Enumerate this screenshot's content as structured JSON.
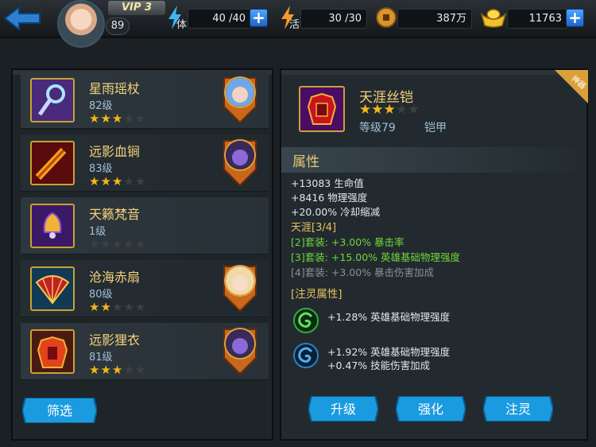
{
  "header": {
    "vip": "VIP 3",
    "player_level": "89",
    "stamina_label": "体",
    "stamina": "40 /40",
    "energy_label": "活",
    "energy": "30 /30",
    "coins": "387万",
    "gold": "11763"
  },
  "items": [
    {
      "name": "星雨瑶杖",
      "level": "82级",
      "stars": 3,
      "icon": "staff-icon",
      "hero": "hero-blue-hair-icon"
    },
    {
      "name": "远影血锏",
      "level": "83级",
      "stars": 3,
      "icon": "mace-icon",
      "hero": "hero-purple-elf-icon"
    },
    {
      "name": "天籁梵音",
      "level": "1级",
      "stars": 0,
      "icon": "bell-icon",
      "hero": ""
    },
    {
      "name": "沧海赤扇",
      "level": "80级",
      "stars": 2,
      "icon": "fan-icon",
      "hero": "hero-blonde-icon"
    },
    {
      "name": "远影狸衣",
      "level": "81级",
      "stars": 3,
      "icon": "armor-icon",
      "hero": "hero-purple-elf-icon"
    }
  ],
  "filter_label": "筛选",
  "detail": {
    "name": "天涯丝铠",
    "stars": 3,
    "level": "等级79",
    "type": "铠甲",
    "tag": "神器",
    "attr_title": "属性",
    "stats": [
      "+13083 生命值",
      "+8416 物理强度",
      "+20.00% 冷却缩减"
    ],
    "set_title": "天涯[3/4]",
    "set_bonuses": [
      {
        "text": "[2]套装: +3.00% 暴击率",
        "active": true
      },
      {
        "text": "[3]套装: +15.00% 英雄基础物理强度",
        "active": true
      },
      {
        "text": "[4]套装: +3.00% 暴击伤害加成",
        "active": false
      }
    ],
    "spirit_title": "[注灵属性]",
    "spirit": [
      {
        "lines": [
          "+1.28% 英雄基础物理强度"
        ],
        "color": "#2fae3a"
      },
      {
        "lines": [
          "+1.92% 英雄基础物理强度",
          "+0.47% 技能伤害加成"
        ],
        "color": "#2a80c8"
      }
    ]
  },
  "buttons": {
    "upgrade": "升级",
    "enhance": "强化",
    "infuse": "注灵"
  },
  "colors": {
    "accent_gold": "#f4d27a",
    "button_blue": "#1c9be0",
    "set_active": "#71d63a"
  }
}
